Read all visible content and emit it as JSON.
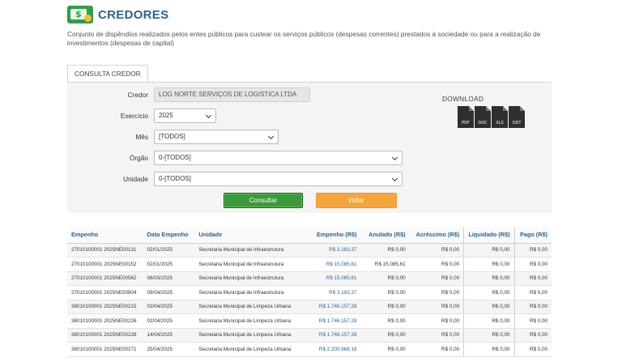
{
  "header": {
    "title": "CREDORES",
    "logo_symbol": "$",
    "description": "Conjunto de dispêndios realizados pelos entes públicos para custear os serviços públicos (despesas correntes) prestados à sociedade ou para a realização de investimentos (despesas de capital)"
  },
  "tab": {
    "label": "CONSULTA CREDOR"
  },
  "form": {
    "credor": {
      "label": "Credor",
      "value": "LOG NORTE SERVIÇOS DE LOGISTICA LTDA"
    },
    "exercicio": {
      "label": "Exercício",
      "value": "2025"
    },
    "mes": {
      "label": "Mês",
      "value": "[TODOS]"
    },
    "orgao": {
      "label": "Órgão",
      "value": "0-[TODOS]"
    },
    "unidade": {
      "label": "Unidade",
      "value": "0-[TODOS]"
    },
    "consultar_label": "Consultar",
    "voltar_label": "Voltar"
  },
  "download": {
    "title": "DOWNLOAD",
    "formats": [
      "PDF",
      "DOC",
      "XLS",
      "ODT"
    ]
  },
  "colors": {
    "accent": "#2a6496",
    "consultar": "#3a9a3a",
    "voltar": "#f5a53a",
    "logo": "#2e9e4a"
  },
  "table": {
    "headers": [
      "Empenho",
      "Data Empenho",
      "Unidade",
      "Empenho (R$)",
      "Anulado (R$)",
      "Acréscimo (R$)",
      "Liquidado (R$)",
      "Pago (R$)"
    ],
    "rows": [
      [
        "27010100001 2025NE00131",
        "02/01/2025",
        "Secretaria Municipal de Infraestrutura",
        "R$ 3.183,37",
        "R$ 0,00",
        "R$ 0,00",
        "R$ 0,00",
        "R$ 0,00"
      ],
      [
        "27010100001 2025NE00152",
        "02/01/2025",
        "Secretaria Municipal de Infraestrutura",
        "R$ 15.085,61",
        "R$ 15.085,61",
        "R$ 0,00",
        "R$ 0,00",
        "R$ 0,00"
      ],
      [
        "27010100001 2025NE00562",
        "06/03/2025",
        "Secretaria Municipal de Infraestrutura",
        "R$ 15.085,61",
        "R$ 0,00",
        "R$ 0,00",
        "R$ 0,00",
        "R$ 0,00"
      ],
      [
        "27010100001 2025NE00804",
        "09/04/2025",
        "Secretaria Municipal de Infraestrutura",
        "R$ 3.183,37",
        "R$ 0,00",
        "R$ 0,00",
        "R$ 0,00",
        "R$ 0,00"
      ],
      [
        "38010100001 2025NE00215",
        "02/04/2025",
        "Secretaria Municipal de Limpeza Urbana",
        "R$ 1.746.157,28",
        "R$ 0,00",
        "R$ 0,00",
        "R$ 0,00",
        "R$ 0,00"
      ],
      [
        "38010100001 2025NE00226",
        "02/04/2025",
        "Secretaria Municipal de Limpeza Urbana",
        "R$ 1.746.157,28",
        "R$ 0,00",
        "R$ 0,00",
        "R$ 0,00",
        "R$ 0,00"
      ],
      [
        "38010100001 2025NE00228",
        "14/04/2025",
        "Secretaria Municipal de Limpeza Urbana",
        "R$ 1.746.157,28",
        "R$ 0,00",
        "R$ 0,00",
        "R$ 0,00",
        "R$ 0,00"
      ],
      [
        "38010100001 2025NE00271",
        "25/04/2025",
        "Secretaria Municipal de Limpeza Urbana",
        "R$ 2.200.968,16",
        "R$ 0,00",
        "R$ 0,00",
        "R$ 0,00",
        "R$ 0,00"
      ]
    ]
  }
}
